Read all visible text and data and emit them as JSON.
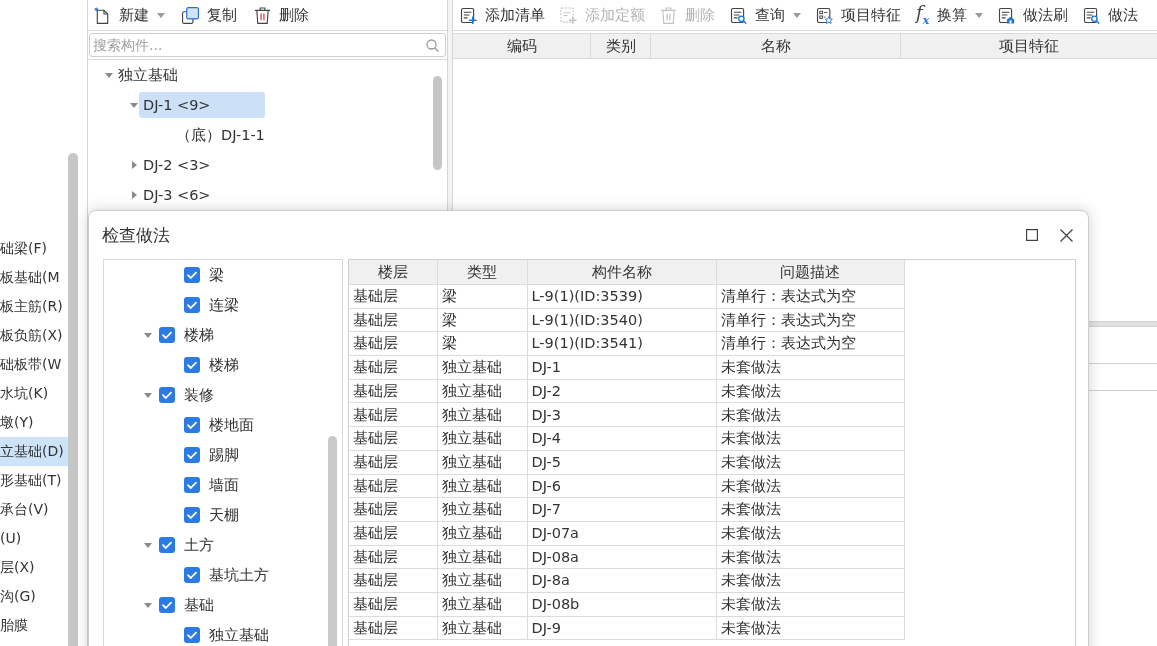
{
  "sidebar": {
    "items": [
      {
        "label": "础梁(F)",
        "selected": false
      },
      {
        "label": "板基础(M",
        "selected": false
      },
      {
        "label": "板主筋(R)",
        "selected": false
      },
      {
        "label": "板负筋(X)",
        "selected": false
      },
      {
        "label": "础板带(W",
        "selected": false
      },
      {
        "label": "水坑(K)",
        "selected": false
      },
      {
        "label": "墩(Y)",
        "selected": false
      },
      {
        "label": "立基础(D)",
        "selected": true
      },
      {
        "label": "形基础(T)",
        "selected": false
      },
      {
        "label": "承台(V)",
        "selected": false
      },
      {
        "label": "(U)",
        "selected": false
      },
      {
        "label": "层(X)",
        "selected": false
      },
      {
        "label": "沟(G)",
        "selected": false
      },
      {
        "label": "胎膜",
        "selected": false
      }
    ]
  },
  "component_panel": {
    "toolbar": [
      {
        "kind": "new",
        "label": "新建",
        "dropdown": true,
        "disabled": false
      },
      {
        "kind": "copy",
        "label": "复制",
        "dropdown": false,
        "disabled": false
      },
      {
        "kind": "delete",
        "label": "删除",
        "dropdown": false,
        "disabled": false
      }
    ],
    "search": {
      "placeholder": "搜索构件..."
    },
    "tree": [
      {
        "label": "独立基础",
        "expanded": true,
        "selected": false,
        "children": [
          {
            "label": "DJ-1 <9>",
            "expanded": true,
            "selected": true,
            "children": [
              {
                "label": "（底）DJ-1-1",
                "selected": false
              }
            ]
          },
          {
            "label": "DJ-2 <3>",
            "expanded": false,
            "selected": false
          },
          {
            "label": "DJ-3 <6>",
            "expanded": false,
            "selected": false
          }
        ]
      }
    ]
  },
  "method_panel": {
    "toolbar": [
      {
        "kind": "add-list",
        "label": "添加清单",
        "dropdown": false,
        "disabled": false
      },
      {
        "kind": "add-quota",
        "label": "添加定额",
        "dropdown": false,
        "disabled": true
      },
      {
        "kind": "delete",
        "label": "删除",
        "dropdown": false,
        "disabled": true
      },
      {
        "kind": "query",
        "label": "查询",
        "dropdown": true,
        "disabled": false
      },
      {
        "kind": "feature",
        "label": "项目特征",
        "dropdown": false,
        "disabled": false
      },
      {
        "kind": "convert",
        "icon_text": "f$_{x}$",
        "label": "换算",
        "dropdown": true,
        "disabled": false
      },
      {
        "kind": "brush",
        "label": "做法刷",
        "dropdown": false,
        "disabled": false
      },
      {
        "kind": "method-query",
        "label": "做法",
        "dropdown": false,
        "disabled": false
      }
    ],
    "table": {
      "columns": [
        "编码",
        "类别",
        "名称",
        "项目特征"
      ]
    }
  },
  "dialog": {
    "title": "检查做法",
    "tree": [
      {
        "kind": "partial",
        "children": [
          {
            "label": "梁",
            "checked": true
          },
          {
            "label": "连梁",
            "checked": true
          }
        ]
      },
      {
        "kind": "group",
        "label": "楼梯",
        "checked": true,
        "expanded": true,
        "children": [
          {
            "label": "楼梯",
            "checked": true
          }
        ]
      },
      {
        "kind": "group",
        "label": "装修",
        "checked": true,
        "expanded": true,
        "children": [
          {
            "label": "楼地面",
            "checked": true
          },
          {
            "label": "踢脚",
            "checked": true
          },
          {
            "label": "墙面",
            "checked": true
          },
          {
            "label": "天棚",
            "checked": true
          }
        ]
      },
      {
        "kind": "group",
        "label": "土方",
        "checked": true,
        "expanded": true,
        "children": [
          {
            "label": "基坑土方",
            "checked": true
          }
        ]
      },
      {
        "kind": "group",
        "label": "基础",
        "checked": true,
        "expanded": true,
        "children": [
          {
            "label": "独立基础",
            "checked": true
          }
        ]
      }
    ],
    "table": {
      "columns": [
        "楼层",
        "类型",
        "构件名称",
        "问题描述"
      ],
      "rows": [
        [
          "基础层",
          "梁",
          "L-9(1)(ID:3539)",
          "清单行：表达式为空"
        ],
        [
          "基础层",
          "梁",
          "L-9(1)(ID:3540)",
          "清单行：表达式为空"
        ],
        [
          "基础层",
          "梁",
          "L-9(1)(ID:3541)",
          "清单行：表达式为空"
        ],
        [
          "基础层",
          "独立基础",
          "DJ-1",
          "未套做法"
        ],
        [
          "基础层",
          "独立基础",
          "DJ-2",
          "未套做法"
        ],
        [
          "基础层",
          "独立基础",
          "DJ-3",
          "未套做法"
        ],
        [
          "基础层",
          "独立基础",
          "DJ-4",
          "未套做法"
        ],
        [
          "基础层",
          "独立基础",
          "DJ-5",
          "未套做法"
        ],
        [
          "基础层",
          "独立基础",
          "DJ-6",
          "未套做法"
        ],
        [
          "基础层",
          "独立基础",
          "DJ-7",
          "未套做法"
        ],
        [
          "基础层",
          "独立基础",
          "DJ-07a",
          "未套做法"
        ],
        [
          "基础层",
          "独立基础",
          "DJ-08a",
          "未套做法"
        ],
        [
          "基础层",
          "独立基础",
          "DJ-8a",
          "未套做法"
        ],
        [
          "基础层",
          "独立基础",
          "DJ-08b",
          "未套做法"
        ],
        [
          "基础层",
          "独立基础",
          "DJ-9",
          "未套做法"
        ]
      ]
    }
  }
}
